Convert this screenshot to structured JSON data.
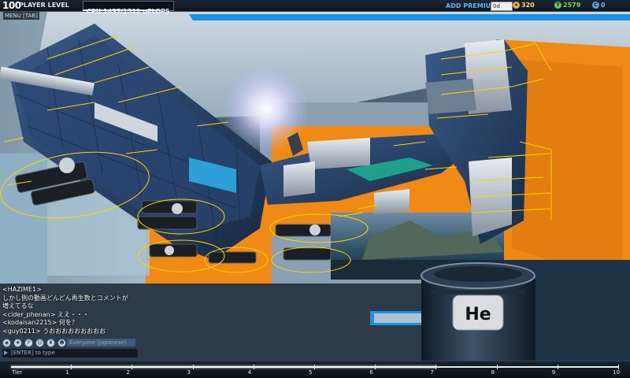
{
  "hud": {
    "level_number": "100",
    "level_label": "PLAYER LEVEL",
    "cpu_readout": "CPU 1437/1511 pFLOPS",
    "cpu_fraction": 0.951,
    "menu_tab": "MENU [TAB]",
    "premium_label": "ADD PREMIUM:",
    "premium_days": "0d",
    "robits": "320",
    "tech_points": "2579",
    "cosmetic_credits": "0"
  },
  "chat": {
    "lines": [
      "<HAZIME1>",
      "しかし例の動画どんどん再生数とコメントが",
      "増えてるな",
      "<cider_phenan> ええ・・・",
      "<kodaisan2215> 何を？",
      "<guy0211> うおおおおおおおおお"
    ],
    "channel_placeholder": "Everyone (Japanese)",
    "input_hint": "[ENTER] to type"
  },
  "tier": {
    "label": "Tier",
    "ticks": [
      "1",
      "2",
      "3",
      "4",
      "5",
      "6",
      "7",
      "8",
      "9",
      "10"
    ],
    "progress_fraction": 0.7
  },
  "world": {
    "block_label": "He"
  },
  "colors": {
    "accent_blue": "#1f8fe0",
    "hull_blue": "#243e63",
    "wall_orange": "#f08a17",
    "wireframe_yellow": "#ffd400"
  }
}
